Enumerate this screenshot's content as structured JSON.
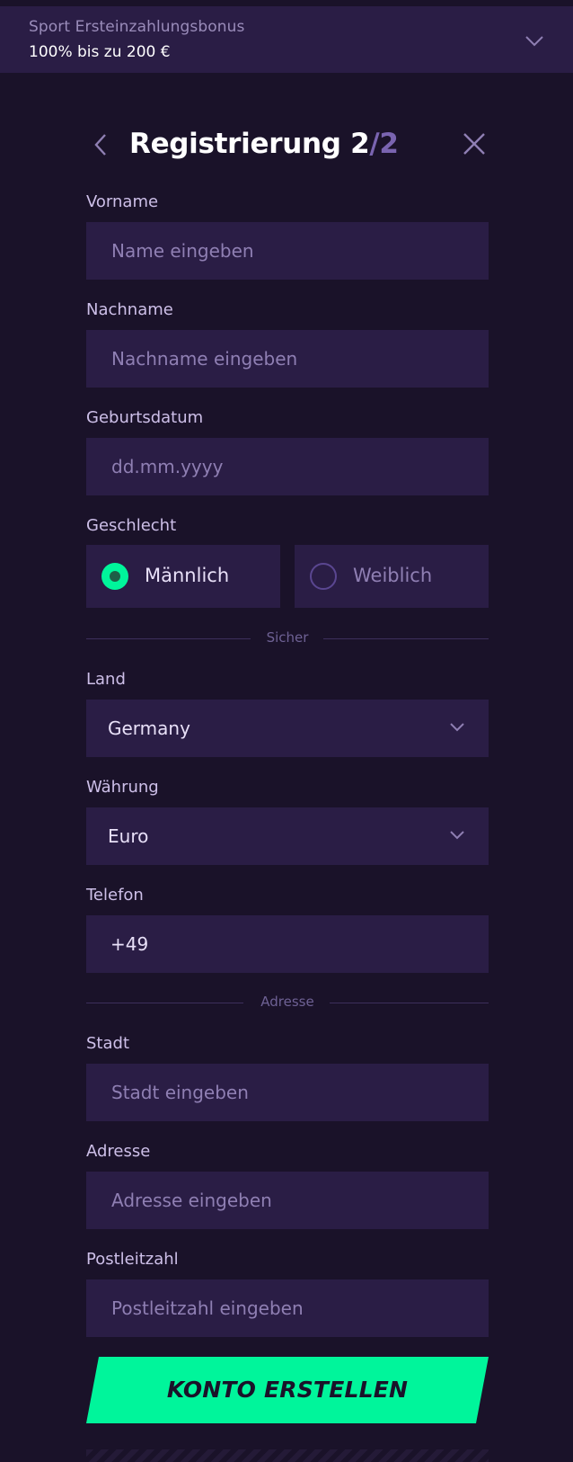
{
  "bonus": {
    "title": "Sport Ersteinzahlungsbonus",
    "value": "100% bis zu 200 €"
  },
  "header": {
    "title": "Registrierung 2",
    "step_separator": "/2"
  },
  "form": {
    "first_name": {
      "label": "Vorname",
      "placeholder": "Name eingeben"
    },
    "last_name": {
      "label": "Nachname",
      "placeholder": "Nachname eingeben"
    },
    "birthdate": {
      "label": "Geburtsdatum",
      "placeholder": "dd.mm.yyyy"
    },
    "gender": {
      "label": "Geschlecht",
      "options": [
        {
          "label": "Männlich",
          "selected": true
        },
        {
          "label": "Weiblich",
          "selected": false
        }
      ]
    },
    "divider_secure": "Sicher",
    "country": {
      "label": "Land",
      "value": "Germany"
    },
    "currency": {
      "label": "Währung",
      "value": "Euro"
    },
    "phone": {
      "label": "Telefon",
      "value": "+49"
    },
    "divider_address": "Adresse",
    "city": {
      "label": "Stadt",
      "placeholder": "Stadt eingeben"
    },
    "address": {
      "label": "Adresse",
      "placeholder": "Adresse eingeben"
    },
    "postal_code": {
      "label": "Postleitzahl",
      "placeholder": "Postleitzahl eingeben"
    },
    "submit_label": "KONTO ERSTELLEN"
  },
  "colors": {
    "background": "#1a1229",
    "field": "#2a1d45",
    "accent": "#00f59b",
    "muted_purple": "#7a64b0"
  },
  "icons": {
    "bonus_toggle": "chevron-down-icon",
    "back": "chevron-left-icon",
    "close": "close-icon",
    "select": "chevron-down-icon"
  }
}
